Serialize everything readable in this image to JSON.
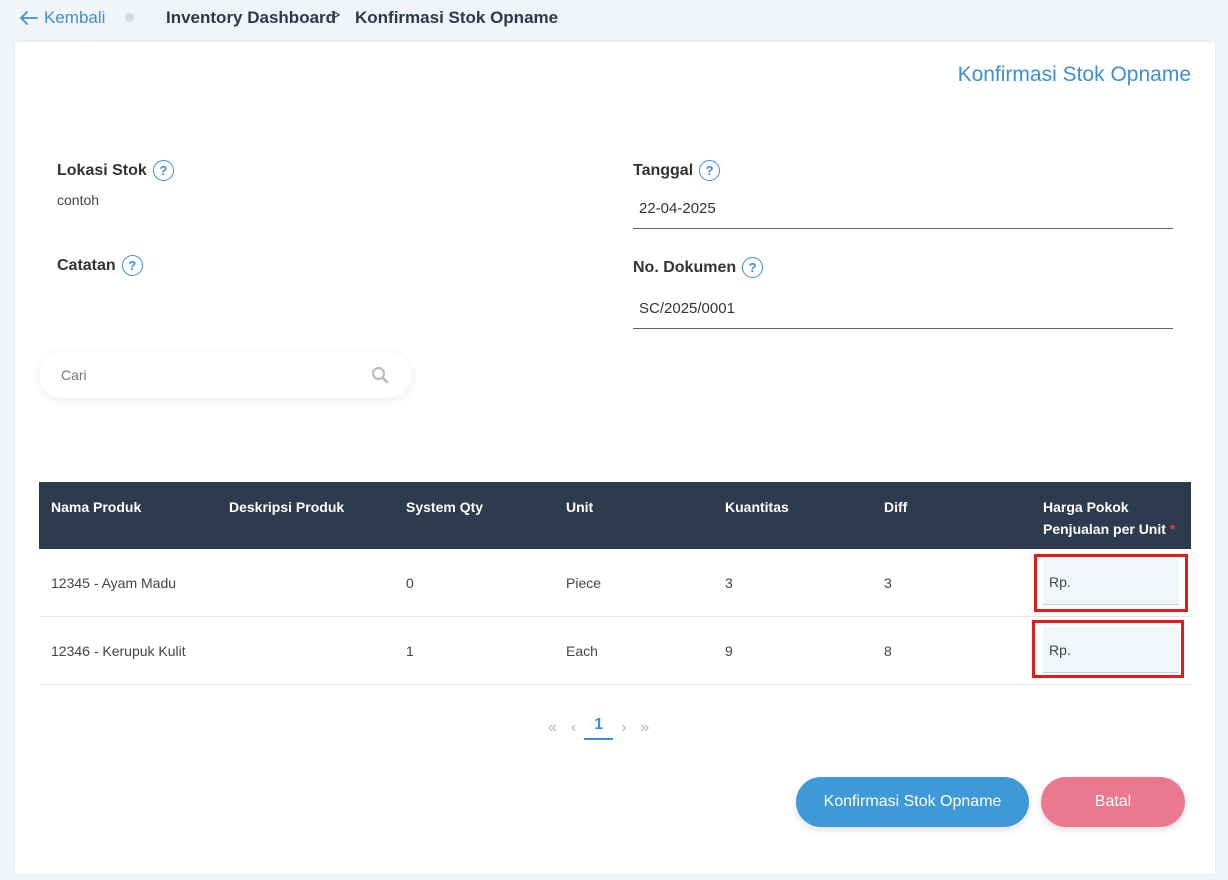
{
  "header": {
    "back_label": "Kembali",
    "breadcrumb_parent": "Inventory Dashboard",
    "breadcrumb_separator": ">",
    "breadcrumb_current": "Konfirmasi Stok Opname"
  },
  "card": {
    "title": "Konfirmasi Stok Opname"
  },
  "form": {
    "location_label": "Lokasi Stok",
    "location_value": "contoh",
    "notes_label": "Catatan",
    "date_label": "Tanggal",
    "date_value": "22-04-2025",
    "doc_label": "No. Dokumen",
    "doc_value": "SC/2025/0001",
    "help_glyph": "?"
  },
  "search": {
    "placeholder": "Cari"
  },
  "table": {
    "columns": {
      "name": "Nama Produk",
      "description": "Deskripsi Produk",
      "system_qty": "System Qty",
      "unit": "Unit",
      "quantity": "Kuantitas",
      "diff": "Diff",
      "price_line1": "Harga Pokok",
      "price_line2": "Penjualan per Unit",
      "required_mark": "*"
    },
    "rows": [
      {
        "name": "12345 - Ayam Madu",
        "description": "",
        "system_qty": "0",
        "unit": "Piece",
        "quantity": "3",
        "diff": "3",
        "price": "Rp."
      },
      {
        "name": "12346 - Kerupuk Kulit",
        "description": "",
        "system_qty": "1",
        "unit": "Each",
        "quantity": "9",
        "diff": "8",
        "price": "Rp."
      }
    ]
  },
  "pagination": {
    "first": "«",
    "prev": "‹",
    "current": "1",
    "next": "›",
    "last": "»"
  },
  "buttons": {
    "confirm": "Konfirmasi Stok Opname",
    "cancel": "Batal"
  },
  "colors": {
    "accent": "#3d8fd1",
    "header_bg": "#2c3b4e",
    "cancel": "#ec7890",
    "highlight": "#e21c1c"
  }
}
